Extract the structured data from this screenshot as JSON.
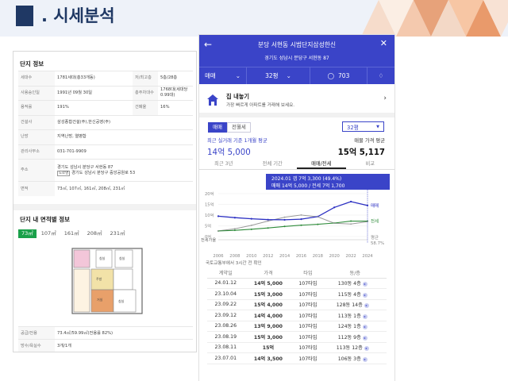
{
  "slide": {
    "title": ". 시세분석",
    "colors": {
      "navy": "#1f3864",
      "accent": "#3a44c8",
      "green": "#1aa04a"
    }
  },
  "left": {
    "complex_title": "단지 정보",
    "rows": [
      {
        "l1": "세대수",
        "v1": "1781세대(총33개동)",
        "l2": "저/최고층",
        "v2": "5층/28층"
      },
      {
        "l1": "사용승인일",
        "v1": "1991년 09월 30일",
        "l2": "총주차대수",
        "v2": "1768대(세대당 0.99대)"
      },
      {
        "l1": "용적률",
        "v1": "191%",
        "l2": "건폐율",
        "v2": "16%"
      },
      {
        "l1": "건설사",
        "v1": "삼성종합건설(주),한신공영(주)"
      },
      {
        "l1": "난방",
        "v1": "지역난방, 열병합"
      },
      {
        "l1": "관리사무소",
        "v1": "031-701-9909"
      },
      {
        "l1": "주소",
        "v1": "경기도 성남시 분당구 서현동 87",
        "road_tag": "도로명",
        "v1b": "경기도 성남시 분당구 중앙공원로 53"
      },
      {
        "l1": "면적",
        "v1": "73㎡, 107㎡, 161㎡, 208㎡, 231㎡"
      }
    ],
    "area_title": "단지 내 면적별 정보",
    "area_tabs": [
      "73㎡",
      "107㎡",
      "161㎡",
      "208㎡",
      "231㎡"
    ],
    "bottom_rows": [
      {
        "l": "공급/전용",
        "v": "73.4㎡/59.99㎡(전용률 82%)"
      },
      {
        "l": "방수/욕실수",
        "v": "3개/1개"
      }
    ],
    "floorplan_labels": [
      "침실",
      "침실",
      "거실",
      "주방",
      "침실"
    ]
  },
  "right": {
    "header_title": "분당 서현동 시범단지삼성한신",
    "address": "경기도 성남시 분당구 서현동 87",
    "icons": {
      "back": "back-arrow-icon",
      "close": "close-icon"
    },
    "bar": {
      "deal": "매매",
      "size": "32평",
      "comments": "703"
    },
    "post": {
      "title": "집 내놓기",
      "subtitle": "가장 빠르게 아파트를 거래해 보세요."
    },
    "toggle": [
      "매매",
      "전월세"
    ],
    "size_select": "32평",
    "recent_label": "최근 실거래 기준 1개월 평균",
    "recent_value": "14억 5,000",
    "avg_label": "매물 가격 평균",
    "avg_value": "15억 5,117",
    "period_tabs": [
      "최근 3년",
      "전체 기간",
      "매매/전세",
      "비교"
    ],
    "source_note": "국토교통부에서 3시간 전 확인",
    "table_headers": [
      "계약일",
      "가격",
      "타입",
      "동/층"
    ],
    "transactions": [
      {
        "date": "24.01.12",
        "price": "14억 5,000",
        "type": "107타입",
        "floor": "130동 4층"
      },
      {
        "date": "23.10.04",
        "price": "15억 3,000",
        "type": "107타입",
        "floor": "115동 4층"
      },
      {
        "date": "23.09.22",
        "price": "15억 4,000",
        "type": "107타입",
        "floor": "128동 14층"
      },
      {
        "date": "23.09.12",
        "price": "14억 4,000",
        "type": "107타입",
        "floor": "113동 1층"
      },
      {
        "date": "23.08.26",
        "price": "13억 9,000",
        "type": "107타입",
        "floor": "124동 1층"
      },
      {
        "date": "23.08.19",
        "price": "15억 3,000",
        "type": "107타입",
        "floor": "112동 9층"
      },
      {
        "date": "23.08.11",
        "price": "15억",
        "type": "107타입",
        "floor": "113동 12층"
      },
      {
        "date": "23.07.01",
        "price": "14억 3,500",
        "type": "107타입",
        "floor": "106동 3층"
      }
    ]
  },
  "chart_data": {
    "type": "line",
    "title": "",
    "xlabel": "",
    "ylabel": "",
    "x": [
      2006,
      2008,
      2010,
      2012,
      2014,
      2016,
      2018,
      2020,
      2022,
      2024
    ],
    "x_ticks": [
      "2006",
      "2008",
      "2010",
      "2012",
      "2014",
      "2016",
      "2018",
      "2020",
      "2022",
      "2024"
    ],
    "y_ticks": [
      "20억",
      "15억",
      "10억",
      "5억",
      "0억"
    ],
    "ylim": [
      0,
      20
    ],
    "ylim2": [
      0,
      100
    ],
    "y2_label": "전세가율",
    "tooltip": {
      "line1": "2024.01 갭 7억 3,300 (49.4%)",
      "line2": "매매 14억 5,000 / 전세 7억 1,700"
    },
    "series": [
      {
        "name": "매매",
        "color": "#2b2fc2",
        "values": [
          9.5,
          8.8,
          8.3,
          7.9,
          7.8,
          8.1,
          9.3,
          13.6,
          16.3,
          14.5
        ]
      },
      {
        "name": "전세",
        "color": "#2e8b3a",
        "values": [
          2.6,
          2.9,
          3.4,
          4.0,
          4.7,
          5.3,
          5.7,
          6.3,
          7.2,
          7.2
        ]
      },
      {
        "name": "전세가율",
        "color": "#9a9a9a",
        "values": [
          28,
          33,
          41,
          51,
          60,
          65,
          61,
          46,
          44,
          49.4
        ]
      }
    ],
    "end_labels": {
      "sale": "매매",
      "jeonse": "전세",
      "ratio": "평균",
      "ratio_value": "58.7%"
    }
  }
}
